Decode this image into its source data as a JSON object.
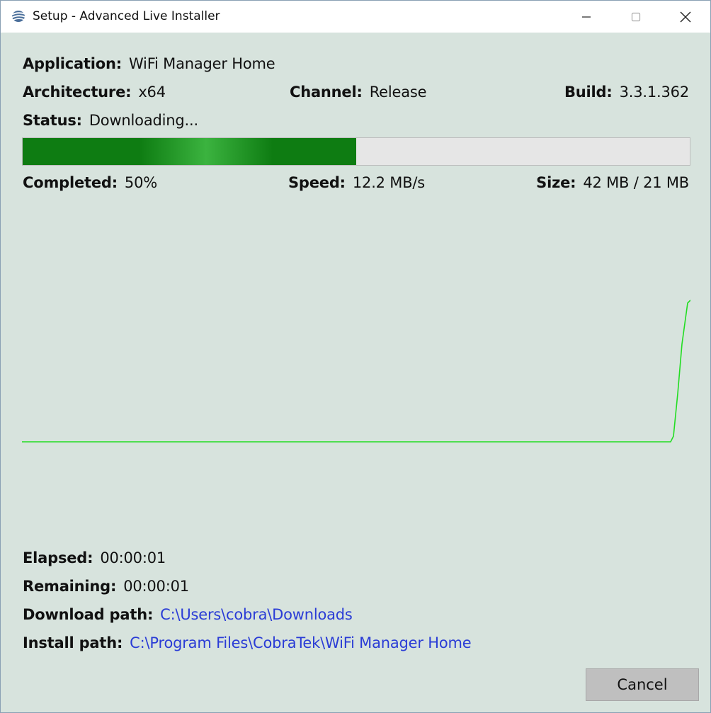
{
  "window": {
    "title": "Setup - Advanced Live Installer",
    "icon": "installer-logo-icon",
    "controls": [
      "minimize-icon",
      "maximize-icon",
      "close-icon"
    ]
  },
  "info": {
    "application": {
      "label": "Application:",
      "value": "WiFi Manager Home"
    },
    "architecture": {
      "label": "Architecture:",
      "value": "x64"
    },
    "channel": {
      "label": "Channel:",
      "value": "Release"
    },
    "build": {
      "label": "Build:",
      "value": "3.3.1.362"
    },
    "status": {
      "label": "Status:",
      "value": "Downloading..."
    }
  },
  "progress": {
    "percent": 50,
    "fill_color": "#0e7c12",
    "completed": {
      "label": "Completed:",
      "value": "50%"
    },
    "speed": {
      "label": "Speed:",
      "value": "12.2 MB/s"
    },
    "size": {
      "label": "Size:",
      "value": "42 MB / 21 MB"
    }
  },
  "speed_graph": {
    "line_color": "#22dd22",
    "shape": "flat line, rising sharply at the right end"
  },
  "times": {
    "elapsed": {
      "label": "Elapsed:",
      "value": "00:00:01"
    },
    "remaining": {
      "label": "Remaining:",
      "value": "00:00:01"
    }
  },
  "paths": {
    "download": {
      "label": "Download path:",
      "value": "C:\\Users\\cobra\\Downloads"
    },
    "install": {
      "label": "Install path:",
      "value": "C:\\Program Files\\CobraTek\\WiFi Manager Home"
    }
  },
  "buttons": {
    "cancel": "Cancel"
  }
}
